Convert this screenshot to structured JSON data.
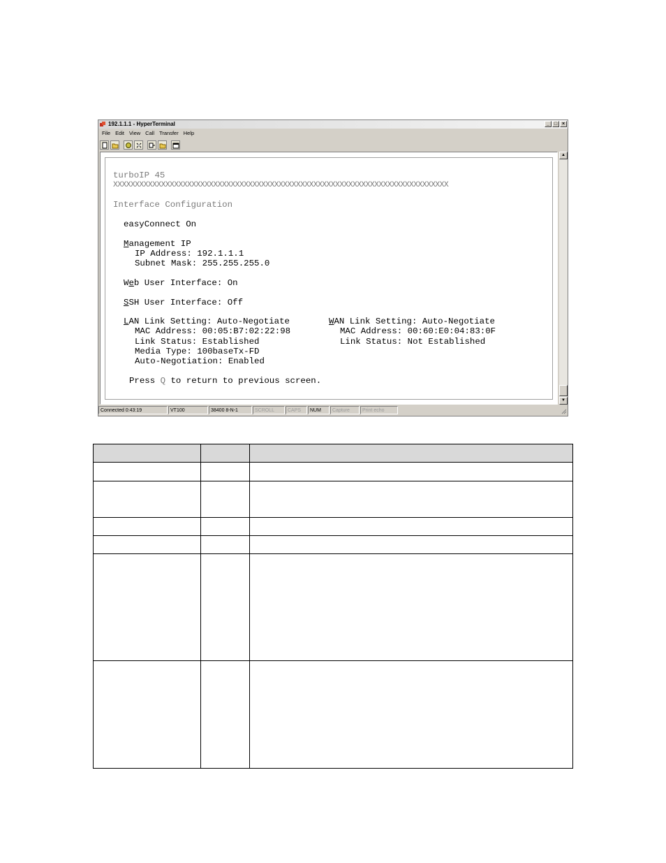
{
  "window": {
    "title": "192.1.1.1 - HyperTerminal",
    "menu": [
      "File",
      "Edit",
      "View",
      "Call",
      "Transfer",
      "Help"
    ],
    "toolbar_icons": [
      "new-icon",
      "open-icon",
      "connect-icon",
      "disconnect-icon",
      "send-icon",
      "receive-icon",
      "properties-icon"
    ]
  },
  "terminal": {
    "product": "turboIP 45",
    "separator": "XXXXXXXXXXXXXXXXXXXXXXXXXXXXXXXXXXXXXXXXXXXXXXXXXXXXXXXXXXXXXXXXXXXXXXXXXXXXX",
    "heading": "Interface Configuration",
    "easyconnect": "easyConnect On",
    "mgmt_key": "M",
    "mgmt_rest": "anagement IP",
    "ip_address": "IP Address: 192.1.1.1",
    "subnet_mask": "Subnet Mask: 255.255.255.0",
    "web_pre": "W",
    "web_key": "e",
    "web_rest": "b User Interface: On",
    "ssh_key": "S",
    "ssh_rest": "SH User Interface: Off",
    "lan_key": "L",
    "lan_rest": "AN Link Setting: Auto-Negotiate",
    "lan_mac": "MAC Address: 00:05:B7:02:22:98",
    "lan_status": "Link Status: Established",
    "lan_media": "Media Type: 100baseTx-FD",
    "lan_autoneg": "Auto-Negotiation: Enabled",
    "wan_key": "W",
    "wan_rest": "AN Link Setting: Auto-Negotiate",
    "wan_mac": "MAC Address: 00:60:E0:04:83:0F",
    "wan_status": "Link Status: Not Established",
    "press_pre": "Press ",
    "press_key": "Q",
    "press_post": " to return to previous screen."
  },
  "statusbar": {
    "connected": "Connected 0:43:19",
    "emulation": "VT100",
    "settings": "38400 8-N-1",
    "scroll": "SCROLL",
    "caps": "CAPS",
    "num": "NUM",
    "capture": "Capture",
    "print_echo": "Print echo"
  }
}
